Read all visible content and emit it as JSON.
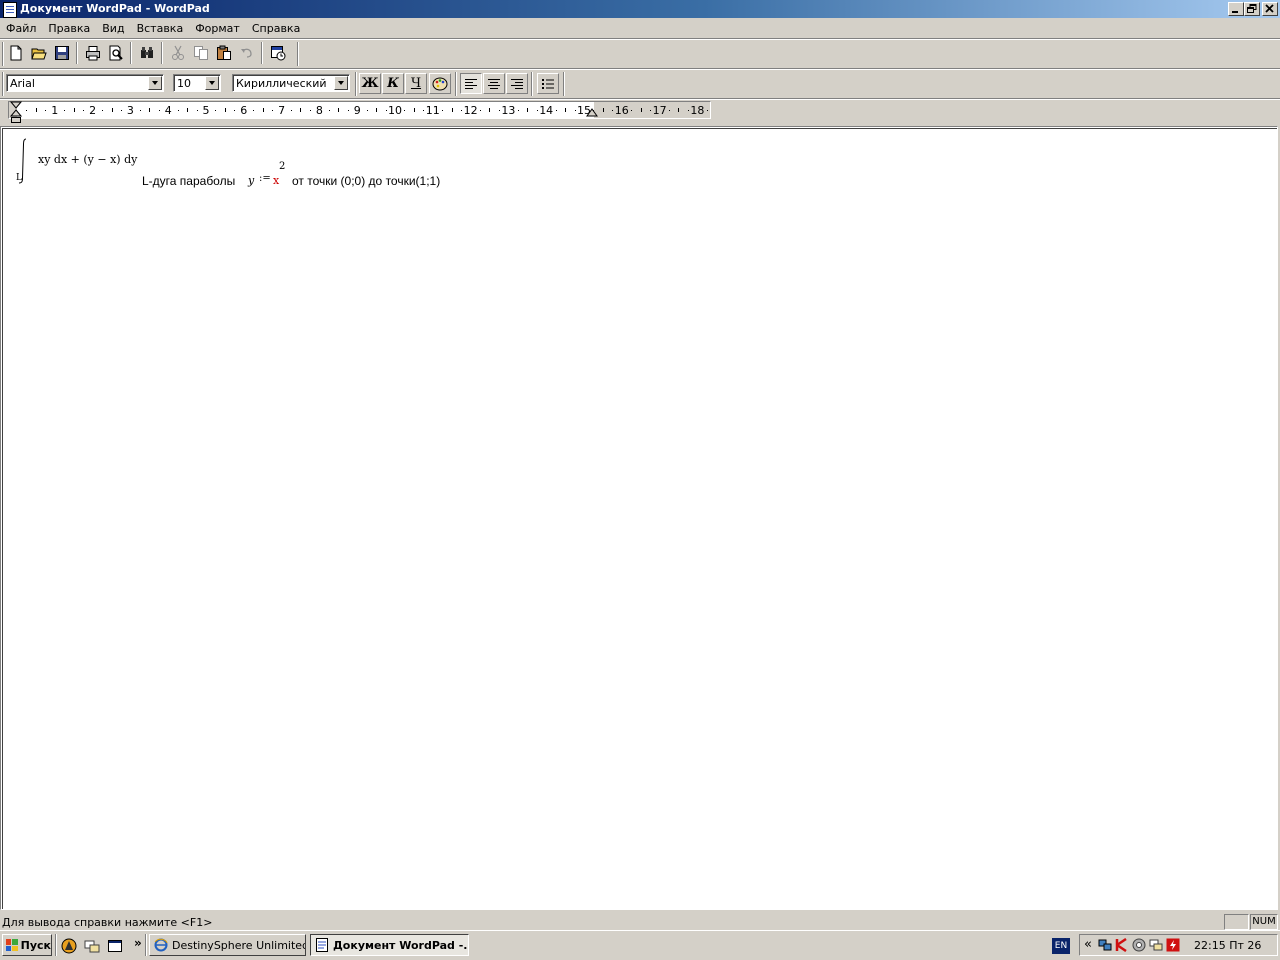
{
  "window": {
    "title": "Документ WordPad - WordPad",
    "controls": [
      "minimize",
      "maximize",
      "close"
    ]
  },
  "menu": [
    "Файл",
    "Правка",
    "Вид",
    "Вставка",
    "Формат",
    "Справка"
  ],
  "toolbar": {
    "icons": [
      "new-document-icon",
      "open-folder-icon",
      "save-disk-icon",
      "print-icon",
      "print-preview-icon",
      "find-binoculars-icon",
      "cut-scissors-icon",
      "copy-icon",
      "paste-icon",
      "undo-icon",
      "insert-datetime-icon"
    ]
  },
  "format_bar": {
    "font": "Arial",
    "size": "10",
    "script": "Кириллический",
    "bold_label": "Ж",
    "italic_label": "К",
    "underline_label": "Ч",
    "align_left_pressed": true
  },
  "ruler": {
    "marks": [
      "1",
      "2",
      "3",
      "4",
      "5",
      "6",
      "7",
      "8",
      "9",
      "10",
      "11",
      "12",
      "13",
      "14",
      "15",
      "16",
      "17",
      "18"
    ]
  },
  "document": {
    "integral_expr": "xy dx + (y − x) dy",
    "integral_sub": "L",
    "condition_label": "L-дуга параболы",
    "eq_lhs": "y",
    "eq_op": ":=",
    "eq_rhs": "x",
    "eq_exp": "2",
    "tail": "от точки (0;0) до точки(1;1)"
  },
  "status": {
    "help": "Для вывода справки нажмите <F1>",
    "num": "NUM"
  },
  "taskbar": {
    "start": "Пуск",
    "tasks": [
      {
        "label": "DestinySphere Unlimited ...",
        "active": false
      },
      {
        "label": "Документ WordPad -...",
        "active": true
      }
    ],
    "lang": "EN",
    "tray_arrow": "«",
    "clock": "22:15 Пт 26"
  },
  "colors": {
    "title_start": "#0a246a",
    "title_end": "#a6caf0",
    "face": "#d4d0c8",
    "math_red": "#cc0000"
  }
}
